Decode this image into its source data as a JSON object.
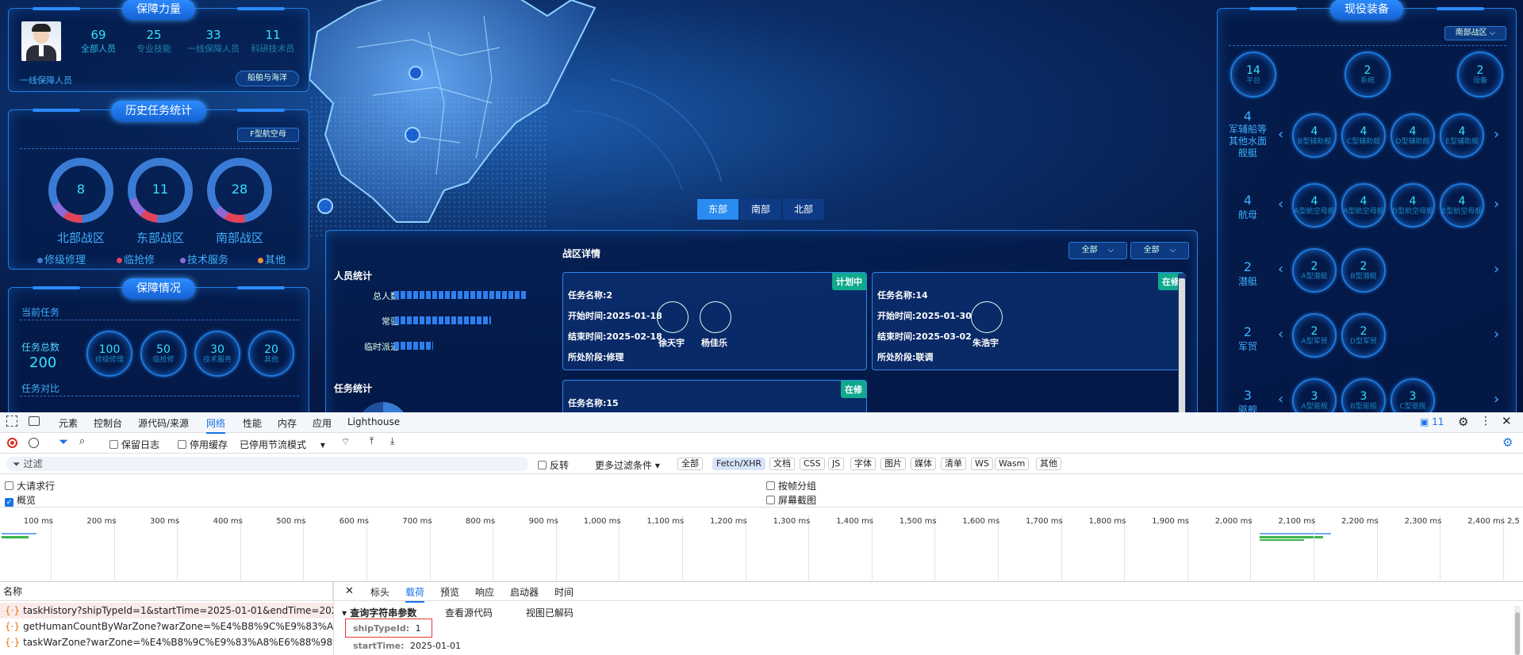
{
  "top": {
    "zone_tabs": [
      "东部",
      "南部",
      "北部"
    ]
  },
  "guarantee_force": {
    "title": "保障力量",
    "stats": [
      {
        "value": "69",
        "label": "全部人员"
      },
      {
        "value": "25",
        "label": "专业技能"
      },
      {
        "value": "33",
        "label": "一线保障人员"
      },
      {
        "value": "11",
        "label": "科研技术员"
      }
    ],
    "link": "一线保障人员",
    "btn": "船舶与海洋"
  },
  "history": {
    "title": "历史任务统计",
    "select": "F型航空母",
    "donuts": [
      {
        "value": "8",
        "label": "北部战区"
      },
      {
        "value": "11",
        "label": "东部战区"
      },
      {
        "value": "28",
        "label": "南部战区"
      }
    ],
    "legend": [
      {
        "label": "修级修理",
        "color": "#3a7bd5"
      },
      {
        "label": "临抢修",
        "color": "#e0435a"
      },
      {
        "label": "技术服务",
        "color": "#8d6ad8"
      },
      {
        "label": "其他",
        "color": "#f08c3e"
      }
    ]
  },
  "guarantee_status": {
    "title": "保障情况",
    "current": "当前任务",
    "total_label": "任务总数",
    "total_value": "200",
    "rings": [
      {
        "value": "100",
        "label": "修级修理"
      },
      {
        "value": "50",
        "label": "临抢修"
      },
      {
        "value": "30",
        "label": "技术服务"
      },
      {
        "value": "20",
        "label": "其他"
      }
    ],
    "compare": "任务对比"
  },
  "detail": {
    "staff_title": "人员统计",
    "staff_rows": [
      {
        "label": "总人数",
        "fill": 0.95
      },
      {
        "label": "常驻",
        "fill": 0.7
      },
      {
        "label": "临时派遣",
        "fill": 0.28
      }
    ],
    "task_stats": "任务统计",
    "zone_title": "战区详情",
    "select1": "全部",
    "select2": "全部",
    "cards": [
      {
        "name": "任务名称:2",
        "start": "开始时间:2025-01-18",
        "end": "结束时间:2025-02-18",
        "stage": "所处阶段:修理",
        "status": "计划中",
        "people": [
          "徐天宇",
          "杨佳乐"
        ]
      },
      {
        "name": "任务名称:14",
        "start": "开始时间:2025-01-30",
        "end": "结束时间:2025-03-02",
        "stage": "所处阶段:联调",
        "status": "在修",
        "people": [
          "朱浩宇"
        ]
      },
      {
        "name": "任务名称:15",
        "start": "",
        "end": "",
        "stage": "",
        "status": "在修",
        "people": []
      }
    ]
  },
  "equipment": {
    "title": "现役装备",
    "select": "南部战区",
    "top_rings": [
      {
        "value": "14",
        "label": "平台"
      },
      {
        "value": "2",
        "label": "系统"
      },
      {
        "value": "2",
        "label": "设备"
      }
    ],
    "rows": [
      {
        "count": "4",
        "name": "军辅船等其他水面舰艇",
        "items": [
          {
            "value": "4",
            "label": "B型辅助舰"
          },
          {
            "value": "4",
            "label": "C型辅助舰"
          },
          {
            "value": "4",
            "label": "D型辅助舰"
          },
          {
            "value": "4",
            "label": "E型辅助舰"
          }
        ]
      },
      {
        "count": "4",
        "name": "航母",
        "items": [
          {
            "value": "4",
            "label": "A型航空母舰"
          },
          {
            "value": "4",
            "label": "A型航空母舰"
          },
          {
            "value": "4",
            "label": "D型航空母舰"
          },
          {
            "value": "4",
            "label": "E型航空母舰"
          }
        ]
      },
      {
        "count": "2",
        "name": "潜艇",
        "items": [
          {
            "value": "2",
            "label": "A型潜艇"
          },
          {
            "value": "2",
            "label": "B型潜艇"
          }
        ]
      },
      {
        "count": "2",
        "name": "军贸",
        "items": [
          {
            "value": "2",
            "label": "A型军贸"
          },
          {
            "value": "2",
            "label": "D型军贸"
          }
        ]
      },
      {
        "count": "3",
        "name": "驱舰",
        "items": [
          {
            "value": "3",
            "label": "A型驱舰"
          },
          {
            "value": "3",
            "label": "B型驱舰"
          },
          {
            "value": "3",
            "label": "C型驱舰"
          }
        ]
      }
    ]
  },
  "devtools": {
    "tabs": [
      "元素",
      "控制台",
      "源代码/来源",
      "网络",
      "性能",
      "内存",
      "应用",
      "Lighthouse"
    ],
    "active_tab": "网络",
    "issues": "11",
    "toolbar": {
      "preserve_log": "保留日志",
      "disable_cache": "停用缓存",
      "throttle": "已停用节流模式"
    },
    "filter_placeholder": "过滤",
    "invert": "反转",
    "more_filters": "更多过滤条件",
    "types": [
      "全部",
      "Fetch/XHR",
      "文档",
      "CSS",
      "JS",
      "字体",
      "图片",
      "媒体",
      "清单",
      "WS",
      "Wasm",
      "其他"
    ],
    "active_type": "Fetch/XHR",
    "opts": {
      "big_rows": "大请求行",
      "overview": "概览",
      "group_by_frame": "按帧分组",
      "screenshots": "屏幕截图"
    },
    "ticks": [
      "100 ms",
      "200 ms",
      "300 ms",
      "400 ms",
      "500 ms",
      "600 ms",
      "700 ms",
      "800 ms",
      "900 ms",
      "1,000 ms",
      "1,100 ms",
      "1,200 ms",
      "1,300 ms",
      "1,400 ms",
      "1,500 ms",
      "1,600 ms",
      "1,700 ms",
      "1,800 ms",
      "1,900 ms",
      "2,000 ms",
      "2,100 ms",
      "2,200 ms",
      "2,300 ms",
      "2,400 ms",
      "2,5"
    ],
    "name_header": "名称",
    "requests": [
      "taskHistory?shipTypeId=1&startTime=2025-01-01&endTime=202...",
      "getHumanCountByWarZone?warZone=%E4%B8%9C%E9%83%A8...",
      "taskWarZone?warZone=%E4%B8%9C%E9%83%A8%E6%88%98%E..."
    ],
    "panel_tabs": [
      "标头",
      "载荷",
      "预览",
      "响应",
      "启动器",
      "时间"
    ],
    "active_panel": "载荷",
    "query_title": "查询字符串参数",
    "view_source": "查看源代码",
    "view_decoded": "视图已解码",
    "params": [
      {
        "key": "shipTypeId:",
        "value": "1"
      },
      {
        "key": "startTime:",
        "value": "2025-01-01"
      }
    ]
  }
}
